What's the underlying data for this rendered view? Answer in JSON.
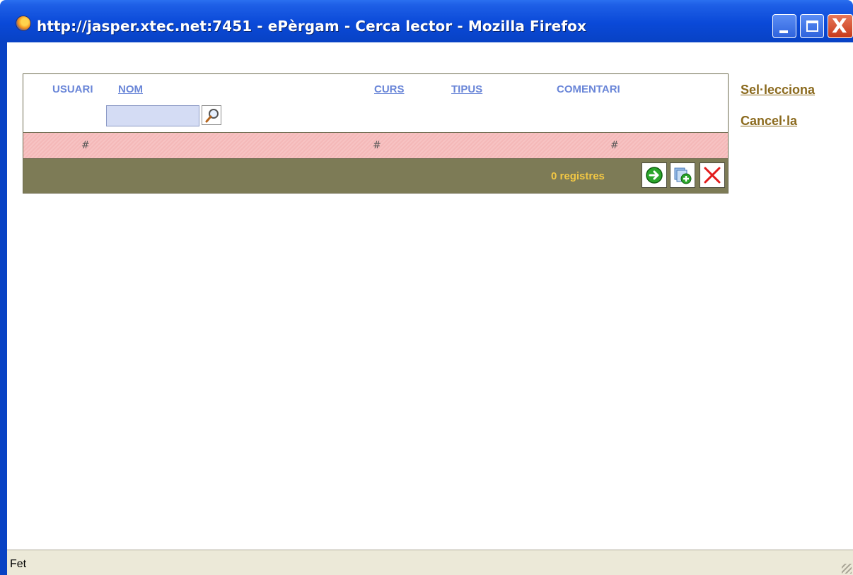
{
  "window": {
    "title": "http://jasper.xtec.net:7451 - ePèrgam - Cerca lector - Mozilla Firefox",
    "close_glyph": "X",
    "icon": "firefox-icon"
  },
  "grid": {
    "columns": {
      "usuari": "USUARI",
      "nom": "NOM",
      "curs": "CURS",
      "tipus": "TIPUS",
      "comentari": "COMENTARI"
    },
    "search": {
      "value": "",
      "placeholder": ""
    },
    "hash_row": [
      "#",
      "#",
      "#"
    ],
    "records_label": "0 registres",
    "buttons": [
      "go-icon",
      "add-record-icon",
      "delete-icon"
    ]
  },
  "actions": {
    "select": "Sel·lecciona",
    "cancel": "Cancel·la"
  },
  "status": {
    "text": "Fet"
  },
  "colors": {
    "title_bar": "#0a49d8",
    "column_label": "#6a86d8",
    "hash_row_bg": "#f4b8b8",
    "footer_bg": "#7d7b56",
    "records_text": "#f2c744",
    "side_link": "#8b6a1e"
  }
}
